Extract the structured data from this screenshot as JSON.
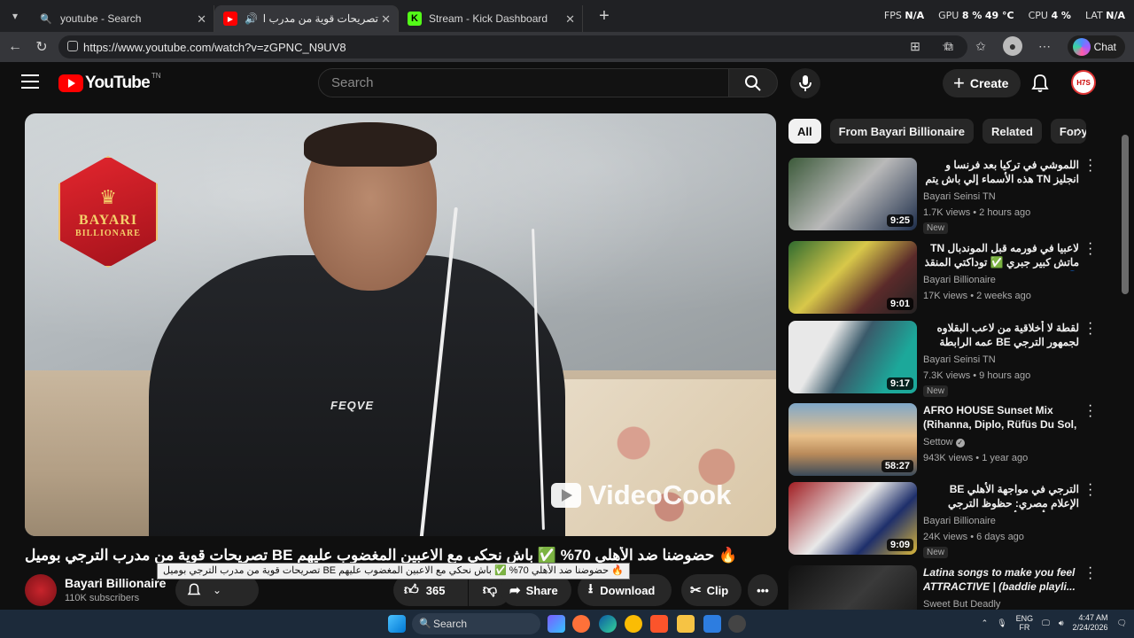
{
  "browser": {
    "tabs": [
      {
        "title": "youtube - Search",
        "icon": "search-icon"
      },
      {
        "title": "تصريحات قوية من مدرب الترجي",
        "icon": "youtube-icon"
      },
      {
        "title": "Stream - Kick Dashboard",
        "icon": "kick-icon"
      }
    ],
    "stats": {
      "fps_label": "FPS",
      "fps": "N/A",
      "gpu_label": "GPU",
      "gpu": "8 %",
      "gpu_temp": "49 °C",
      "cpu_label": "CPU",
      "cpu": "4 %",
      "lat_label": "LAT",
      "lat": "N/A"
    },
    "url": "https://www.youtube.com/watch?v=zGPNC_N9UV8",
    "chat_label": "Chat"
  },
  "youtube": {
    "logo_text": "YouTube",
    "country": "TN",
    "search_placeholder": "Search",
    "create_label": "Create",
    "avatar_text": "H7S"
  },
  "video": {
    "badge_top": "BAYARI",
    "badge_bottom": "BILLIONARE",
    "hoodie_text": "FEQVE",
    "watermark": "VideoCook",
    "title": "🔥 حضوضنا ضد الأهلي 70% ✅ باش نحكي مع الاعبين المغضوب عليهم BE تصريحات قوية من مدرب الترجي بوميل",
    "tooltip": "🔥 حضوضنا ضد الأهلي 70% ✅ باش نحكي مع الاعبين المغضوب عليهم BE تصريحات قوية من مدرب الترجي بوميل",
    "channel": "Bayari Billionaire",
    "subscribers": "110K subscribers",
    "likes": "365",
    "share_label": "Share",
    "download_label": "Download",
    "clip_label": "Clip"
  },
  "sidebar": {
    "chips": [
      "All",
      "From Bayari Billionaire",
      "Related",
      "For you"
    ],
    "items": [
      {
        "title": "اللموشي في تركيا بعد فرنسا و انجليز TN هذه الأسماء إلي باش يتم إقصائها التربص ...",
        "channel": "Bayari Seinsi TN",
        "meta": "1.7K views • 2 hours ago",
        "duration": "9:25",
        "badge": "New",
        "rtl": true
      },
      {
        "title": "لاعبيا في فورمه قبل الموندبال TN ماتش كبير جبري ✅ توداكتي المنقذ 🔵 بن سليمان",
        "channel": "Bayari Billionaire",
        "meta": "17K views • 2 weeks ago",
        "duration": "9:01",
        "badge": "",
        "rtl": true
      },
      {
        "title": "لقطة لا أخلاقية من لاعب البقلاوه لجمهور الترجي BE عمه الرابطة تتحرك كيف ما ...",
        "channel": "Bayari Seinsi TN",
        "meta": "7.3K views • 9 hours ago",
        "duration": "9:17",
        "badge": "New",
        "rtl": true
      },
      {
        "title": "AFRO HOUSE Sunset Mix (Rihanna, Diplo, Rüfüs Du Sol, ...",
        "channel": "Settow",
        "meta": "943K views • 1 year ago",
        "duration": "58:27",
        "badge": "",
        "rtl": false
      },
      {
        "title": "الترجي في مواجهة الأهلي BE الإعلام مصري: حظوظ الترجي متعدمة أمام الأهلي ...",
        "channel": "Bayari Billionaire",
        "meta": "24K views • 6 days ago",
        "duration": "9:09",
        "badge": "New",
        "rtl": true
      },
      {
        "title": "Latina songs to make you feel ATTRACTIVE | (baddie playli...",
        "channel": "Sweet But Deadly",
        "meta": "",
        "duration": "",
        "badge": "",
        "rtl": false
      }
    ]
  },
  "taskbar": {
    "search_label": "Search",
    "lang_top": "ENG",
    "lang_bottom": "FR",
    "time": "4:47 AM",
    "date": "2/24/2026"
  }
}
